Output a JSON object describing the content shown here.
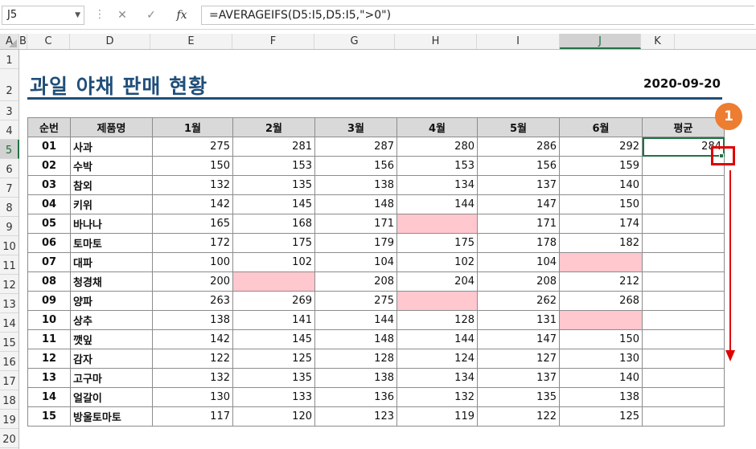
{
  "formula_bar": {
    "name_box": "J5",
    "formula": "=AVERAGEIFS(D5:I5,D5:I5,\">0\")",
    "cancel_icon": "✕",
    "enter_icon": "✓",
    "fx_label": "fx"
  },
  "columns": [
    "A",
    "B",
    "C",
    "D",
    "E",
    "F",
    "G",
    "H",
    "I",
    "J",
    "K"
  ],
  "rows": [
    "1",
    "2",
    "3",
    "4",
    "5",
    "6",
    "7",
    "8",
    "9",
    "10",
    "11",
    "12",
    "13",
    "14",
    "15",
    "16",
    "17",
    "18",
    "19",
    "20"
  ],
  "sheet": {
    "title": "과일 야채 판매 현황",
    "date": "2020-09-20",
    "headers": [
      "순번",
      "제품명",
      "1월",
      "2월",
      "3월",
      "4월",
      "5월",
      "6월",
      "평균"
    ],
    "data": [
      {
        "no": "01",
        "name": "사과",
        "m": [
          "275",
          "281",
          "287",
          "280",
          "286",
          "292"
        ],
        "avg": "284"
      },
      {
        "no": "02",
        "name": "수박",
        "m": [
          "150",
          "153",
          "156",
          "153",
          "156",
          "159"
        ],
        "avg": ""
      },
      {
        "no": "03",
        "name": "참외",
        "m": [
          "132",
          "135",
          "138",
          "134",
          "137",
          "140"
        ],
        "avg": ""
      },
      {
        "no": "04",
        "name": "키위",
        "m": [
          "142",
          "145",
          "148",
          "144",
          "147",
          "150"
        ],
        "avg": ""
      },
      {
        "no": "05",
        "name": "바나나",
        "m": [
          "165",
          "168",
          "171",
          "",
          "171",
          "174"
        ],
        "avg": ""
      },
      {
        "no": "06",
        "name": "토마토",
        "m": [
          "172",
          "175",
          "179",
          "175",
          "178",
          "182"
        ],
        "avg": ""
      },
      {
        "no": "07",
        "name": "대파",
        "m": [
          "100",
          "102",
          "104",
          "102",
          "104",
          ""
        ],
        "avg": ""
      },
      {
        "no": "08",
        "name": "청경채",
        "m": [
          "200",
          "",
          "208",
          "204",
          "208",
          "212"
        ],
        "avg": ""
      },
      {
        "no": "09",
        "name": "양파",
        "m": [
          "263",
          "269",
          "275",
          "",
          "262",
          "268"
        ],
        "avg": ""
      },
      {
        "no": "10",
        "name": "상추",
        "m": [
          "138",
          "141",
          "144",
          "128",
          "131",
          ""
        ],
        "avg": ""
      },
      {
        "no": "11",
        "name": "깻잎",
        "m": [
          "142",
          "145",
          "148",
          "144",
          "147",
          "150"
        ],
        "avg": ""
      },
      {
        "no": "12",
        "name": "감자",
        "m": [
          "122",
          "125",
          "128",
          "124",
          "127",
          "130"
        ],
        "avg": ""
      },
      {
        "no": "13",
        "name": "고구마",
        "m": [
          "132",
          "135",
          "138",
          "134",
          "137",
          "140"
        ],
        "avg": ""
      },
      {
        "no": "14",
        "name": "얼갈이",
        "m": [
          "130",
          "133",
          "136",
          "132",
          "135",
          "138"
        ],
        "avg": ""
      },
      {
        "no": "15",
        "name": "방울토마토",
        "m": [
          "117",
          "120",
          "123",
          "119",
          "122",
          "125"
        ],
        "avg": ""
      }
    ]
  },
  "annotation": {
    "step": "1",
    "highlight_color": "#ffc7ce",
    "accent_color": "#e00000",
    "badge_color": "#ed7d31",
    "title_color": "#1f4e79"
  }
}
